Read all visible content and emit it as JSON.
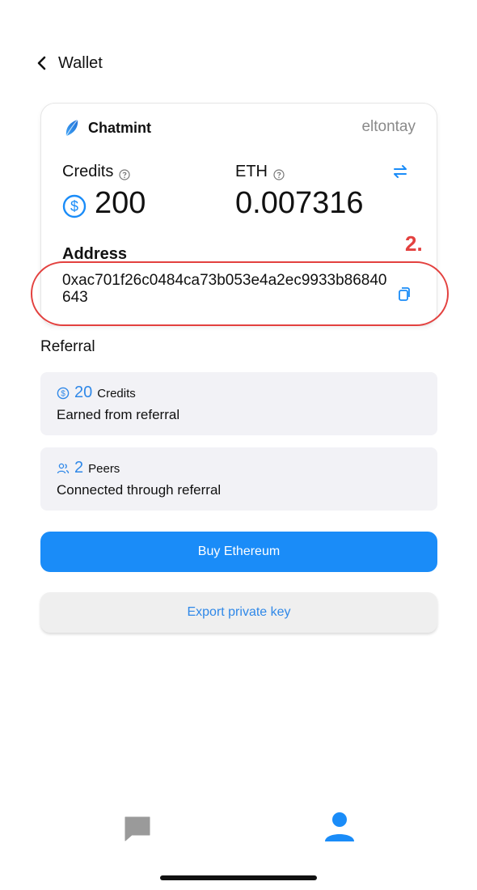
{
  "header": {
    "title": "Wallet"
  },
  "card": {
    "brand_name": "Chatmint",
    "username": "eltontay",
    "credits": {
      "label": "Credits",
      "value": "200"
    },
    "eth": {
      "label": "ETH",
      "value": "0.007316"
    },
    "address_label": "Address",
    "address_value": "0xac701f26c0484ca73b053e4a2ec9933b86840643"
  },
  "annotation": {
    "label": "2.",
    "color": "#e3413f"
  },
  "referral": {
    "title": "Referral",
    "items": [
      {
        "icon": "dollar-circle-icon",
        "number": "20",
        "unit": "Credits",
        "description": "Earned from referral"
      },
      {
        "icon": "people-icon",
        "number": "2",
        "unit": "Peers",
        "description": "Connected through referral"
      }
    ]
  },
  "buttons": {
    "buy_label": "Buy Ethereum",
    "export_label": "Export private key"
  },
  "tabbar": {
    "items": [
      {
        "icon": "chat-bubble-icon"
      },
      {
        "icon": "user-profile-icon"
      }
    ]
  },
  "colors": {
    "accent": "#1a8cf8",
    "link": "#2f88e8",
    "annotation": "#e3413f",
    "tile_bg": "#f2f2f6"
  }
}
